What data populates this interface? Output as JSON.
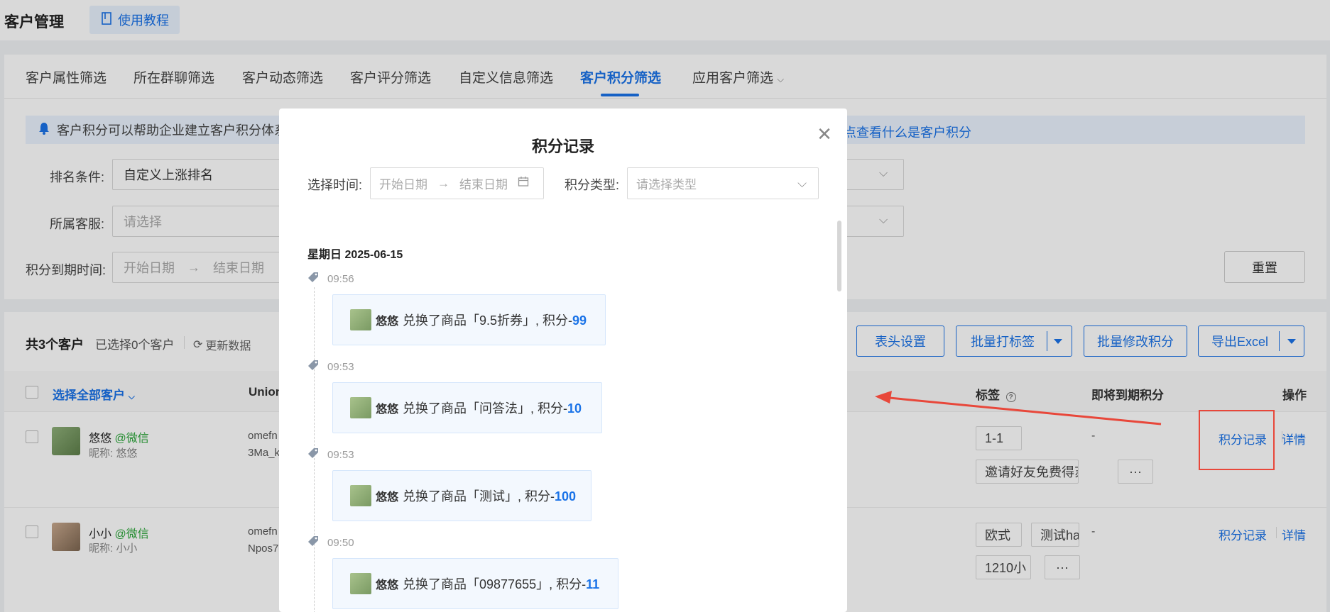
{
  "header": {
    "title": "客户管理",
    "tutorial_label": "使用教程"
  },
  "tabs": [
    {
      "label": "客户属性筛选"
    },
    {
      "label": "所在群聊筛选"
    },
    {
      "label": "客户动态筛选"
    },
    {
      "label": "客户评分筛选"
    },
    {
      "label": "自定义信息筛选"
    },
    {
      "label": "客户积分筛选",
      "active": true
    },
    {
      "label": "应用客户筛选"
    }
  ],
  "notice": {
    "text": "客户积分可以帮助企业建立客户积分体系",
    "link": "点查看什么是客户积分"
  },
  "filters": {
    "rank_label": "排名条件:",
    "rank_value": "自定义上涨排名",
    "service_label": "所属客服:",
    "service_placeholder": "请选择",
    "expire_label": "积分到期时间:",
    "expire_start": "开始日期",
    "expire_end": "结束日期",
    "reset_label": "重置"
  },
  "list": {
    "count": "共3个客户",
    "selected": "已选择0个客户",
    "refresh": "更新数据",
    "buttons": {
      "header_settings": "表头设置",
      "batch_tag": "批量打标签",
      "batch_points": "批量修改积分",
      "export": "导出Excel"
    },
    "columns": {
      "select_all": "选择全部客户",
      "union": "Union",
      "tags": "标签",
      "expiring": "即将到期积分",
      "ops": "操作"
    },
    "rows": [
      {
        "name": "悠悠",
        "source": "@微信",
        "nickname": "昵称: 悠悠",
        "union1": "omefn",
        "union2": "3Ma_k",
        "tags": [
          "1-1",
          "邀请好友免费得苏"
        ],
        "expiring": "-",
        "op_points": "积分记录",
        "op_detail": "详情"
      },
      {
        "name": "小小",
        "source": "@微信",
        "nickname": "昵称: 小小",
        "union1": "omefn",
        "union2": "Npos7",
        "tags": [
          "欧式",
          "测试ha",
          "1210小"
        ],
        "expiring": "-",
        "op_points": "积分记录",
        "op_detail": "详情"
      }
    ]
  },
  "modal": {
    "title": "积分记录",
    "time_label": "选择时间:",
    "start_placeholder": "开始日期",
    "end_placeholder": "结束日期",
    "type_label": "积分类型:",
    "type_placeholder": "请选择类型",
    "day": "星期日 2025-06-15",
    "records": [
      {
        "time": "09:56",
        "name": "悠悠",
        "text": "兑换了商品「9.5折券」, 积分-",
        "points": "99"
      },
      {
        "time": "09:53",
        "name": "悠悠",
        "text": "兑换了商品「问答法」, 积分-",
        "points": "10"
      },
      {
        "time": "09:53",
        "name": "悠悠",
        "text": "兑换了商品「测试」, 积分-",
        "points": "100"
      },
      {
        "time": "09:50",
        "name": "悠悠",
        "text": "兑换了商品「09877655」, 积分-",
        "points": "11"
      }
    ]
  },
  "colors": {
    "accent": "#1a73e8",
    "annotation": "#e8473a",
    "wechat_green": "#2aa538"
  }
}
